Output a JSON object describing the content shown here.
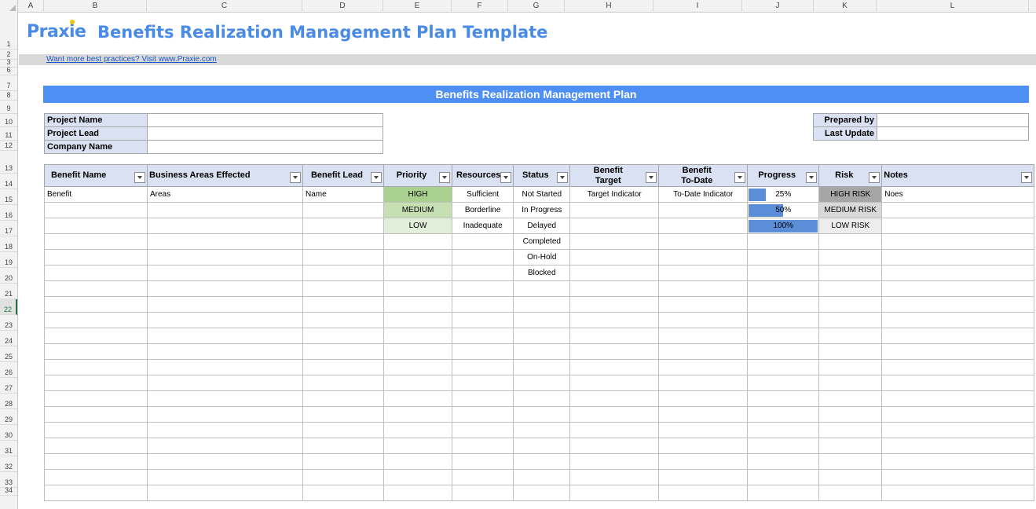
{
  "sheet": {
    "columns": [
      "A",
      "B",
      "C",
      "D",
      "E",
      "F",
      "G",
      "H",
      "I",
      "J",
      "K",
      "L"
    ],
    "rows": [
      "1",
      "2",
      "3",
      "6",
      "7",
      "8",
      "9",
      "10",
      "11",
      "12",
      "13",
      "14",
      "15",
      "16",
      "17",
      "18",
      "19",
      "20",
      "21",
      "22",
      "23",
      "24",
      "25",
      "26",
      "27",
      "28",
      "29",
      "30",
      "31",
      "32",
      "33",
      "34"
    ],
    "selected_row": "22"
  },
  "brand": {
    "logo": "Praxie",
    "color": "#4a8be6"
  },
  "title": "Benefits Realization Management Plan Template",
  "link": "Want more best practices? Visit www.Praxie.com",
  "section_title": "Benefits Realization Management Plan",
  "project_info": {
    "project_name_label": "Project Name",
    "project_lead_label": "Project Lead",
    "company_name_label": "Company Name",
    "prepared_by_label": "Prepared by",
    "last_update_label": "Last Update"
  },
  "table": {
    "headers": {
      "benefit_name": "Benefit Name",
      "business_areas": "Business Areas Effected",
      "benefit_lead": "Benefit Lead",
      "priority": "Priority",
      "resources": "Resources",
      "status": "Status",
      "benefit_target_1": "Benefit",
      "benefit_target_2": "Target",
      "benefit_todate_1": "Benefit",
      "benefit_todate_2": "To-Date",
      "progress": "Progress",
      "risk": "Risk",
      "notes": "Notes"
    },
    "rows": [
      {
        "benefit": "Benefit",
        "areas": "Areas",
        "lead": "Name",
        "priority": "HIGH",
        "resource": "Sufficient",
        "status": "Not Started",
        "target": "Target Indicator",
        "todate": "To-Date Indicator",
        "progress_label": "25%",
        "progress": 0.25,
        "risk": "HIGH RISK",
        "notes": "Noes"
      },
      {
        "benefit": "",
        "areas": "",
        "lead": "",
        "priority": "MEDIUM",
        "resource": "Borderline",
        "status": "In Progress",
        "target": "",
        "todate": "",
        "progress_label": "50%",
        "progress": 0.5,
        "risk": "MEDIUM RISK",
        "notes": ""
      },
      {
        "benefit": "",
        "areas": "",
        "lead": "",
        "priority": "LOW",
        "resource": "Inadequate",
        "status": "Delayed",
        "target": "",
        "todate": "",
        "progress_label": "100%",
        "progress": 1.0,
        "risk": "LOW RISK",
        "notes": ""
      },
      {
        "status": "Completed"
      },
      {
        "status": "On-Hold"
      },
      {
        "status": "Blocked"
      }
    ],
    "empty_rows": 14
  }
}
